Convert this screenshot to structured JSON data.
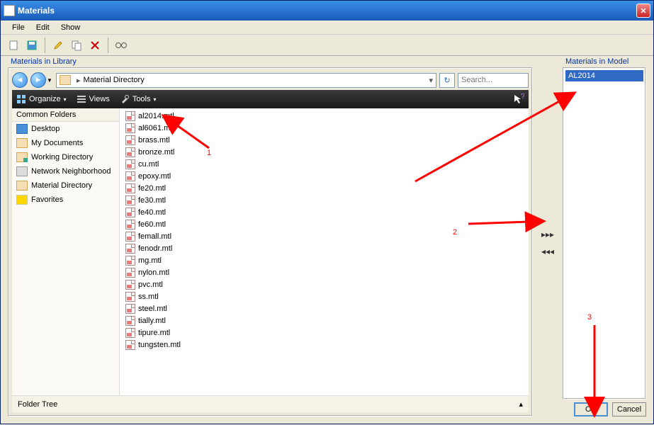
{
  "window": {
    "title": "Materials"
  },
  "menu": {
    "file": "File",
    "edit": "Edit",
    "show": "Show"
  },
  "library": {
    "label": "Materials in Library",
    "path_text": "Material Directory",
    "search_placeholder": "Search...",
    "toolbar": {
      "organize": "Organize",
      "views": "Views",
      "tools": "Tools"
    },
    "common_folders_label": "Common Folders",
    "folders": [
      {
        "label": "Desktop",
        "name": "folder-desktop",
        "icon": "ic-desktop"
      },
      {
        "label": "My Documents",
        "name": "folder-mydocs",
        "icon": "ic-mydocs"
      },
      {
        "label": "Working Directory",
        "name": "folder-working",
        "icon": "ic-working"
      },
      {
        "label": "Network Neighborhood",
        "name": "folder-network",
        "icon": "ic-network"
      },
      {
        "label": "Material Directory",
        "name": "folder-materialdir",
        "icon": "ic-matdir"
      },
      {
        "label": "Favorites",
        "name": "folder-favorites",
        "icon": "ic-fav"
      }
    ],
    "files": [
      "al2014.mtl",
      "al6061.mtl",
      "brass.mtl",
      "bronze.mtl",
      "cu.mtl",
      "epoxy.mtl",
      "fe20.mtl",
      "fe30.mtl",
      "fe40.mtl",
      "fe60.mtl",
      "femall.mtl",
      "fenodr.mtl",
      "mg.mtl",
      "nylon.mtl",
      "pvc.mtl",
      "ss.mtl",
      "steel.mtl",
      "tially.mtl",
      "tipure.mtl",
      "tungsten.mtl"
    ],
    "folder_tree_label": "Folder Tree"
  },
  "model": {
    "label": "Materials in Model",
    "items": [
      "AL2014"
    ]
  },
  "buttons": {
    "ok": "OK",
    "cancel": "Cancel"
  },
  "annotations": {
    "a1": "1",
    "a2": "2",
    "a3": "3"
  }
}
